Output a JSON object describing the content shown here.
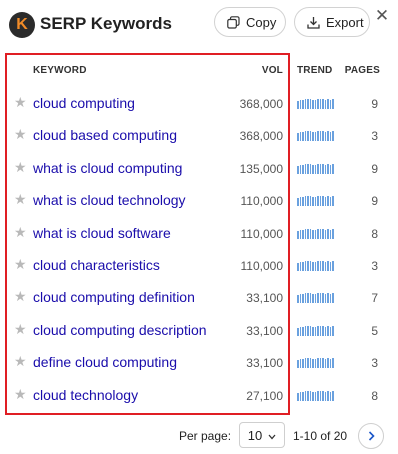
{
  "header": {
    "logo_letter": "K",
    "title": "SERP Keywords",
    "copy_label": "Copy",
    "export_label": "Export",
    "close_glyph": "✕"
  },
  "table": {
    "columns": {
      "keyword": "KEYWORD",
      "vol": "VOL",
      "trend": "TREND",
      "pages": "PAGES"
    },
    "rows": [
      {
        "keyword": "cloud computing",
        "vol": "368,000",
        "pages": "9"
      },
      {
        "keyword": "cloud based computing",
        "vol": "368,000",
        "pages": "3"
      },
      {
        "keyword": "what is cloud computing",
        "vol": "135,000",
        "pages": "9"
      },
      {
        "keyword": "what is cloud technology",
        "vol": "110,000",
        "pages": "9"
      },
      {
        "keyword": "what is cloud software",
        "vol": "110,000",
        "pages": "8"
      },
      {
        "keyword": "cloud characteristics",
        "vol": "110,000",
        "pages": "3"
      },
      {
        "keyword": "cloud computing definition",
        "vol": "33,100",
        "pages": "7"
      },
      {
        "keyword": "cloud computing description",
        "vol": "33,100",
        "pages": "5"
      },
      {
        "keyword": "define cloud computing",
        "vol": "33,100",
        "pages": "3"
      },
      {
        "keyword": "cloud technology",
        "vol": "27,100",
        "pages": "8"
      }
    ]
  },
  "footer": {
    "per_page_label": "Per page:",
    "per_page_value": "10",
    "range_text": "1-10 of 20"
  },
  "colors": {
    "link": "#1a0dab",
    "trend_bar": "#6aa1df",
    "highlight_border": "#e01e24",
    "logo_bg": "#2b2b2b",
    "logo_letter": "#f28c28"
  },
  "icons": {
    "star": "star-icon",
    "copy": "copy-icon",
    "export": "export-icon",
    "close": "close-icon",
    "next": "chevron-right-icon",
    "dropdown": "chevron-down-icon"
  }
}
